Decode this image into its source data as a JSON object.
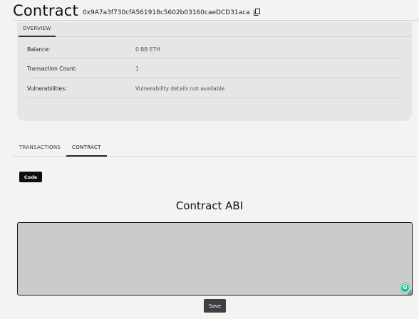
{
  "header": {
    "title": "Contract",
    "address": "0x9A7a3f730cfA561918c5602b03160caeDCD31aca",
    "copy_icon": "copy-icon"
  },
  "overview": {
    "tab_label": "OVERVIEW",
    "rows": [
      {
        "label": "Balance:",
        "value": "0 BB ETH"
      },
      {
        "label": "Transaction Count:",
        "value": "1"
      },
      {
        "label": "Vulnerabilities:",
        "value": "Vulnerability details not available"
      }
    ]
  },
  "tabs": [
    {
      "label": "TRANSACTIONS",
      "active": false
    },
    {
      "label": "CONTRACT",
      "active": true
    }
  ],
  "contract": {
    "code_button": "Code",
    "abi_title": "Contract ABI",
    "abi_value": "",
    "save_button": "Save"
  },
  "colors": {
    "background": "#f3f3f1",
    "card": "#e6e6e6",
    "textarea": "#cbcbcb",
    "button_dark": "#0d0d0d",
    "save_button": "#3c3f43",
    "grammarly": "#15c39a"
  }
}
